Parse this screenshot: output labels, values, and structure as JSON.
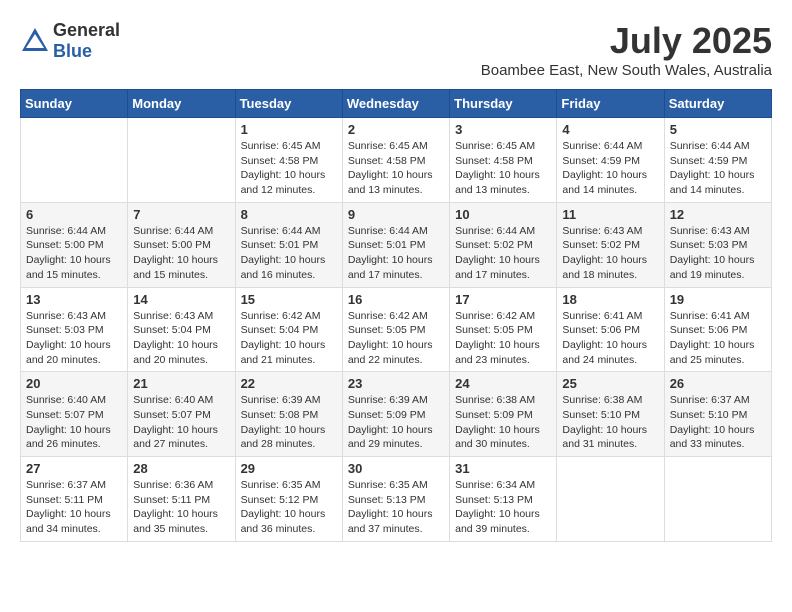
{
  "header": {
    "logo_general": "General",
    "logo_blue": "Blue",
    "month_year": "July 2025",
    "location": "Boambee East, New South Wales, Australia"
  },
  "weekdays": [
    "Sunday",
    "Monday",
    "Tuesday",
    "Wednesday",
    "Thursday",
    "Friday",
    "Saturday"
  ],
  "weeks": [
    [
      {
        "day": "",
        "info": ""
      },
      {
        "day": "",
        "info": ""
      },
      {
        "day": "1",
        "info": "Sunrise: 6:45 AM\nSunset: 4:58 PM\nDaylight: 10 hours\nand 12 minutes."
      },
      {
        "day": "2",
        "info": "Sunrise: 6:45 AM\nSunset: 4:58 PM\nDaylight: 10 hours\nand 13 minutes."
      },
      {
        "day": "3",
        "info": "Sunrise: 6:45 AM\nSunset: 4:58 PM\nDaylight: 10 hours\nand 13 minutes."
      },
      {
        "day": "4",
        "info": "Sunrise: 6:44 AM\nSunset: 4:59 PM\nDaylight: 10 hours\nand 14 minutes."
      },
      {
        "day": "5",
        "info": "Sunrise: 6:44 AM\nSunset: 4:59 PM\nDaylight: 10 hours\nand 14 minutes."
      }
    ],
    [
      {
        "day": "6",
        "info": "Sunrise: 6:44 AM\nSunset: 5:00 PM\nDaylight: 10 hours\nand 15 minutes."
      },
      {
        "day": "7",
        "info": "Sunrise: 6:44 AM\nSunset: 5:00 PM\nDaylight: 10 hours\nand 15 minutes."
      },
      {
        "day": "8",
        "info": "Sunrise: 6:44 AM\nSunset: 5:01 PM\nDaylight: 10 hours\nand 16 minutes."
      },
      {
        "day": "9",
        "info": "Sunrise: 6:44 AM\nSunset: 5:01 PM\nDaylight: 10 hours\nand 17 minutes."
      },
      {
        "day": "10",
        "info": "Sunrise: 6:44 AM\nSunset: 5:02 PM\nDaylight: 10 hours\nand 17 minutes."
      },
      {
        "day": "11",
        "info": "Sunrise: 6:43 AM\nSunset: 5:02 PM\nDaylight: 10 hours\nand 18 minutes."
      },
      {
        "day": "12",
        "info": "Sunrise: 6:43 AM\nSunset: 5:03 PM\nDaylight: 10 hours\nand 19 minutes."
      }
    ],
    [
      {
        "day": "13",
        "info": "Sunrise: 6:43 AM\nSunset: 5:03 PM\nDaylight: 10 hours\nand 20 minutes."
      },
      {
        "day": "14",
        "info": "Sunrise: 6:43 AM\nSunset: 5:04 PM\nDaylight: 10 hours\nand 20 minutes."
      },
      {
        "day": "15",
        "info": "Sunrise: 6:42 AM\nSunset: 5:04 PM\nDaylight: 10 hours\nand 21 minutes."
      },
      {
        "day": "16",
        "info": "Sunrise: 6:42 AM\nSunset: 5:05 PM\nDaylight: 10 hours\nand 22 minutes."
      },
      {
        "day": "17",
        "info": "Sunrise: 6:42 AM\nSunset: 5:05 PM\nDaylight: 10 hours\nand 23 minutes."
      },
      {
        "day": "18",
        "info": "Sunrise: 6:41 AM\nSunset: 5:06 PM\nDaylight: 10 hours\nand 24 minutes."
      },
      {
        "day": "19",
        "info": "Sunrise: 6:41 AM\nSunset: 5:06 PM\nDaylight: 10 hours\nand 25 minutes."
      }
    ],
    [
      {
        "day": "20",
        "info": "Sunrise: 6:40 AM\nSunset: 5:07 PM\nDaylight: 10 hours\nand 26 minutes."
      },
      {
        "day": "21",
        "info": "Sunrise: 6:40 AM\nSunset: 5:07 PM\nDaylight: 10 hours\nand 27 minutes."
      },
      {
        "day": "22",
        "info": "Sunrise: 6:39 AM\nSunset: 5:08 PM\nDaylight: 10 hours\nand 28 minutes."
      },
      {
        "day": "23",
        "info": "Sunrise: 6:39 AM\nSunset: 5:09 PM\nDaylight: 10 hours\nand 29 minutes."
      },
      {
        "day": "24",
        "info": "Sunrise: 6:38 AM\nSunset: 5:09 PM\nDaylight: 10 hours\nand 30 minutes."
      },
      {
        "day": "25",
        "info": "Sunrise: 6:38 AM\nSunset: 5:10 PM\nDaylight: 10 hours\nand 31 minutes."
      },
      {
        "day": "26",
        "info": "Sunrise: 6:37 AM\nSunset: 5:10 PM\nDaylight: 10 hours\nand 33 minutes."
      }
    ],
    [
      {
        "day": "27",
        "info": "Sunrise: 6:37 AM\nSunset: 5:11 PM\nDaylight: 10 hours\nand 34 minutes."
      },
      {
        "day": "28",
        "info": "Sunrise: 6:36 AM\nSunset: 5:11 PM\nDaylight: 10 hours\nand 35 minutes."
      },
      {
        "day": "29",
        "info": "Sunrise: 6:35 AM\nSunset: 5:12 PM\nDaylight: 10 hours\nand 36 minutes."
      },
      {
        "day": "30",
        "info": "Sunrise: 6:35 AM\nSunset: 5:13 PM\nDaylight: 10 hours\nand 37 minutes."
      },
      {
        "day": "31",
        "info": "Sunrise: 6:34 AM\nSunset: 5:13 PM\nDaylight: 10 hours\nand 39 minutes."
      },
      {
        "day": "",
        "info": ""
      },
      {
        "day": "",
        "info": ""
      }
    ]
  ]
}
